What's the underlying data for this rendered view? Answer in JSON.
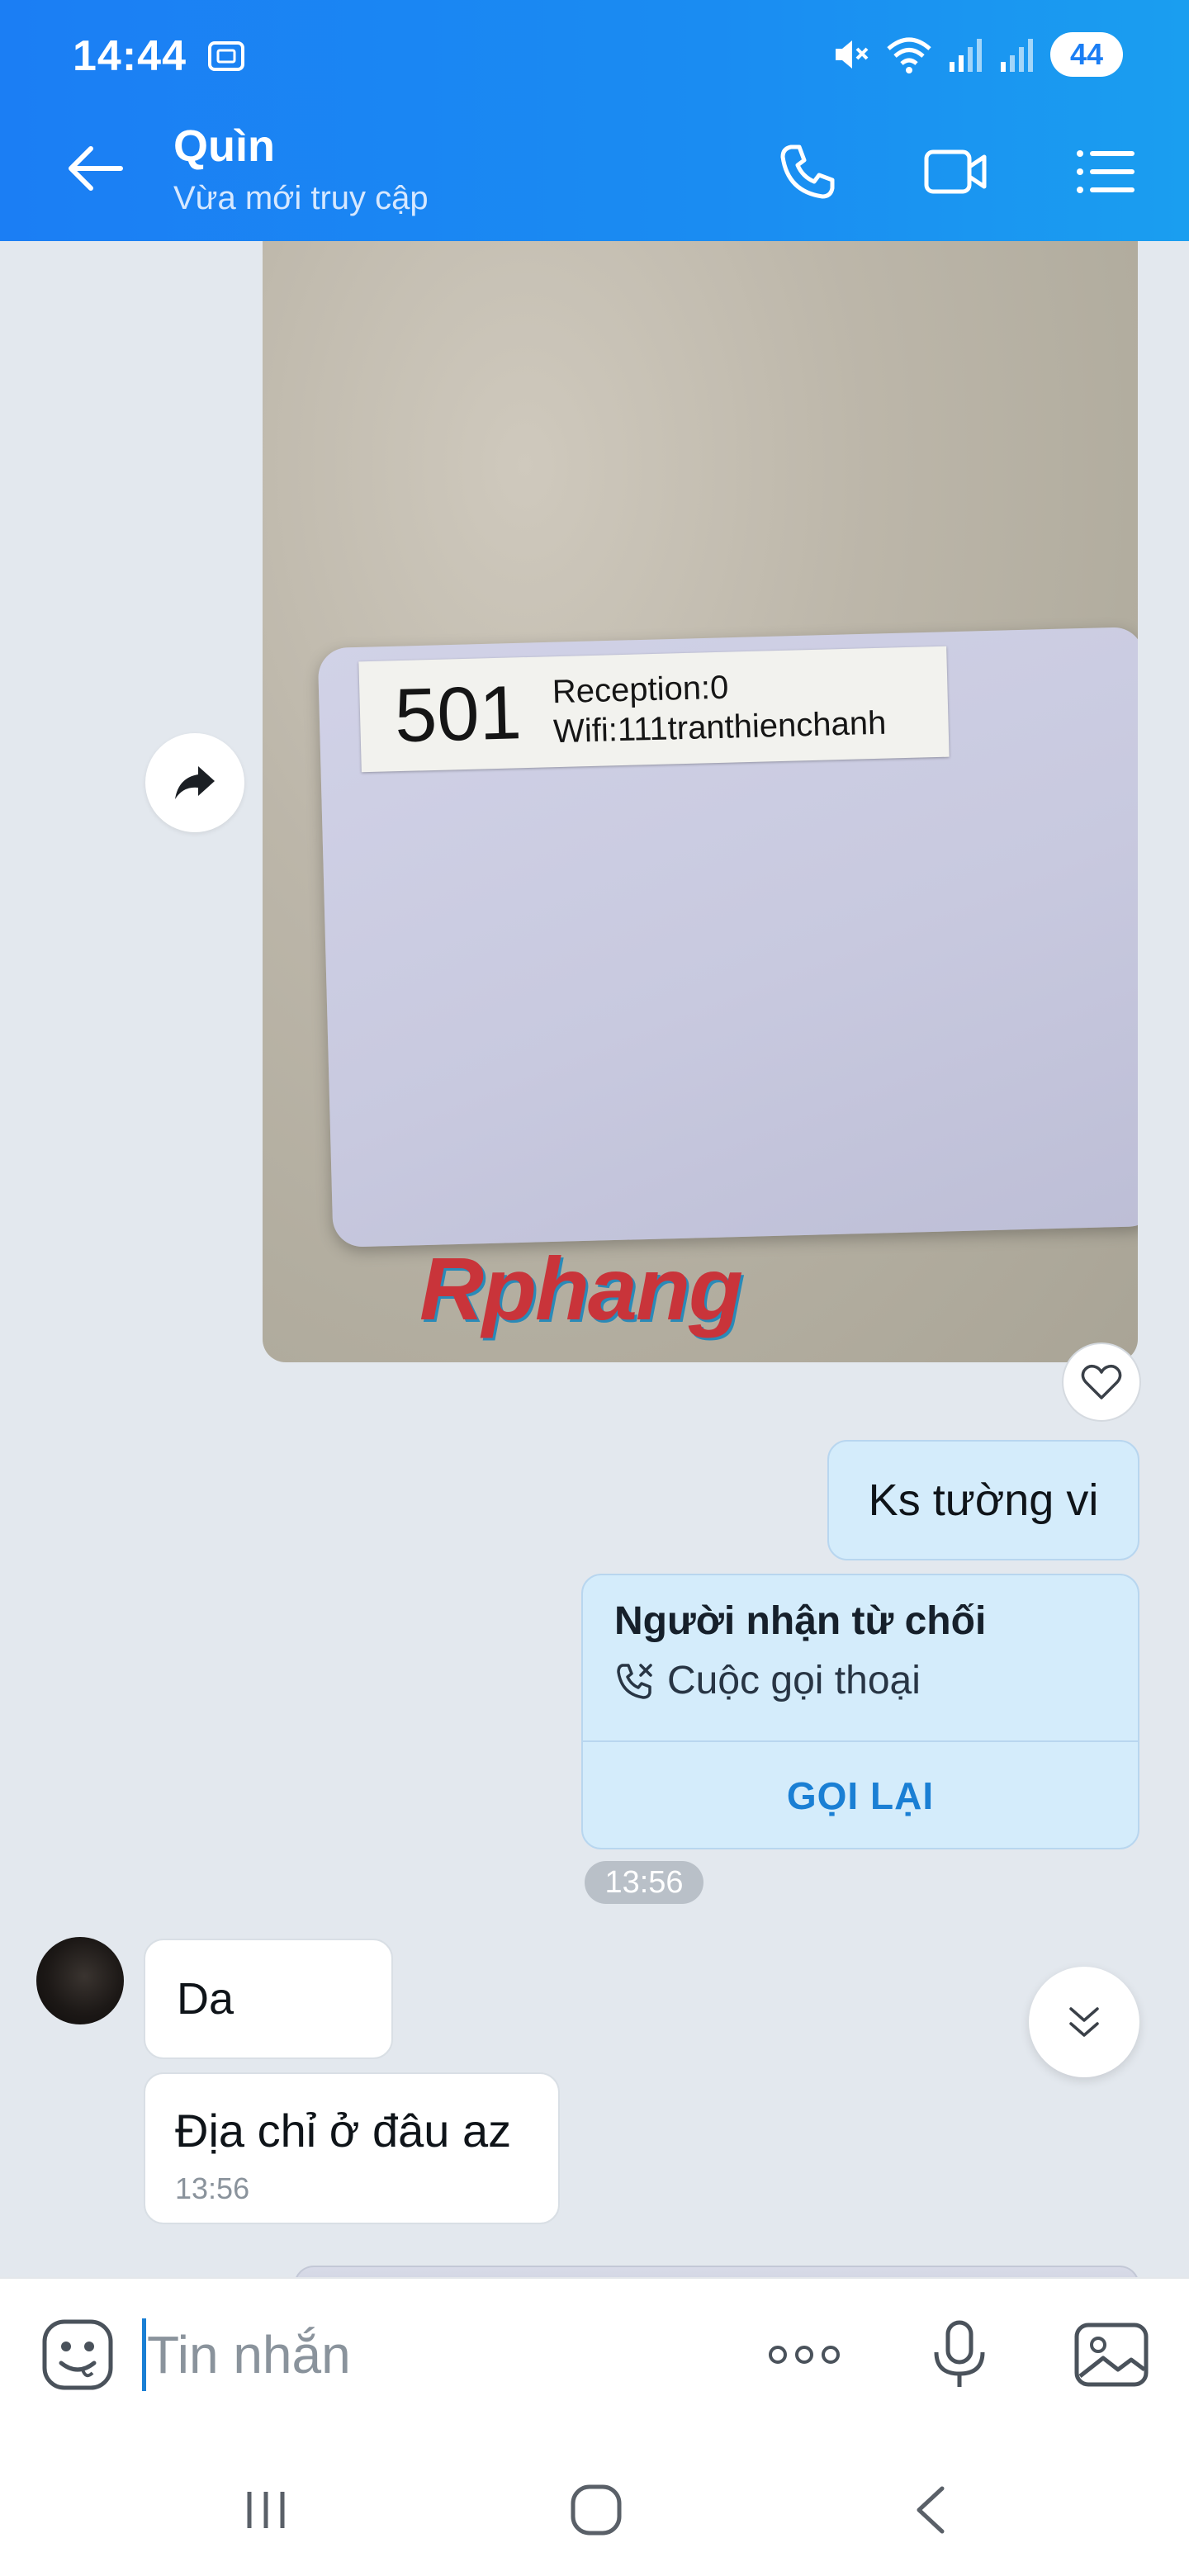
{
  "status_bar": {
    "time": "14:44",
    "battery": "44",
    "icons": [
      "screenshot-icon",
      "mute-icon",
      "wifi-icon",
      "signal-icon",
      "signal-icon"
    ]
  },
  "header": {
    "contact_name": "Quìn",
    "contact_status": "Vừa mới truy cập",
    "actions": [
      "back-arrow-icon",
      "phone-icon",
      "video-call-icon",
      "menu-icon"
    ]
  },
  "messages": {
    "photo": {
      "room_number": "501",
      "reception": "Reception:0",
      "wifi": "Wifi:111tranthienchanh",
      "watermark": "Rphang"
    },
    "outgoing_text": "Ks tường vi",
    "call_card": {
      "title": "Người nhận từ chối",
      "subtitle": "Cuộc gọi thoại",
      "action": "GỌI LẠI"
    },
    "call_time": "13:56",
    "incoming": [
      {
        "text": "Da"
      },
      {
        "text": "Địa chỉ ở đâu az",
        "time": "13:56"
      }
    ]
  },
  "composer": {
    "placeholder": "Tin nhắn"
  },
  "colors": {
    "header_blue": "#1b7ef4",
    "outgoing_bubble": "#d4ecfb",
    "action_blue": "#1a7fd4",
    "chat_background": "#e3e8ee"
  }
}
